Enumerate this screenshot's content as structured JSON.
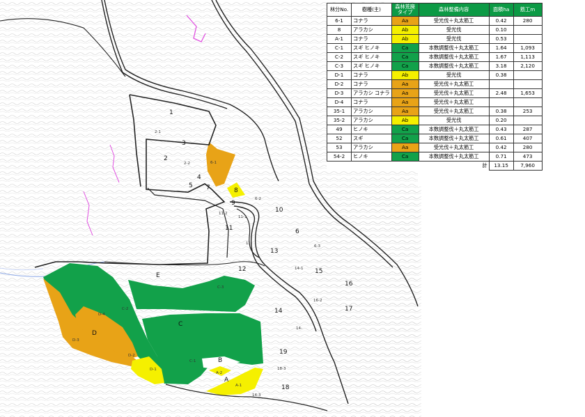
{
  "table": {
    "headers": {
      "no": "林分No.",
      "species": "樹種(主)",
      "type": "森林荒廃タイプ",
      "work": "森林整備内容",
      "area": "面積ha",
      "length": "筋工m"
    },
    "rows": [
      {
        "no": "6-1",
        "species": "コナラ",
        "type": "Aa",
        "work": "受光伐＋丸太筋工",
        "area": "0.42",
        "length": "280"
      },
      {
        "no": "8",
        "species": "アラカシ",
        "type": "Ab",
        "work": "受光伐",
        "area": "0.10",
        "length": ""
      },
      {
        "no": "A-1",
        "species": "コナラ",
        "type": "Ab",
        "work": "受光伐",
        "area": "0.53",
        "length": ""
      },
      {
        "no": "C-1",
        "species": "スギ ヒノキ",
        "type": "Ca",
        "work": "本数調整伐＋丸太筋工",
        "area": "1.64",
        "length": "1,093"
      },
      {
        "no": "C-2",
        "species": "スギ ヒノキ",
        "type": "Ca",
        "work": "本数調整伐＋丸太筋工",
        "area": "1.67",
        "length": "1,113"
      },
      {
        "no": "C-3",
        "species": "スギ ヒノキ",
        "type": "Ca",
        "work": "本数調整伐＋丸太筋工",
        "area": "3.18",
        "length": "2,120"
      },
      {
        "no": "D-1",
        "species": "コナラ",
        "type": "Ab",
        "work": "受光伐",
        "area": "0.38",
        "length": ""
      },
      {
        "no": "D-2",
        "species": "コナラ",
        "type": "Aa",
        "work": "受光伐＋丸太筋工",
        "area": "",
        "length": ""
      },
      {
        "no": "D-3",
        "species": "アラカシ コナラ",
        "type": "Aa",
        "work": "受光伐＋丸太筋工",
        "area": "2.48",
        "length": "1,653"
      },
      {
        "no": "D-4",
        "species": "コナラ",
        "type": "Aa",
        "work": "受光伐＋丸太筋工",
        "area": "",
        "length": ""
      },
      {
        "no": "35-1",
        "species": "アラカシ",
        "type": "Aa",
        "work": "受光伐＋丸太筋工",
        "area": "0.38",
        "length": "253"
      },
      {
        "no": "35-2",
        "species": "アラカシ",
        "type": "Ab",
        "work": "受光伐",
        "area": "0.20",
        "length": ""
      },
      {
        "no": "49",
        "species": "ヒノキ",
        "type": "Ca",
        "work": "本数調整伐＋丸太筋工",
        "area": "0.43",
        "length": "287"
      },
      {
        "no": "52",
        "species": "スギ",
        "type": "Ca",
        "work": "本数調整伐＋丸太筋工",
        "area": "0.61",
        "length": "407"
      },
      {
        "no": "53",
        "species": "アラカシ",
        "type": "Aa",
        "work": "受光伐＋丸太筋工",
        "area": "0.42",
        "length": "280"
      },
      {
        "no": "54-2",
        "species": "ヒノキ",
        "type": "Ca",
        "work": "本数調整伐＋丸太筋工",
        "area": "0.71",
        "length": "473"
      }
    ],
    "total": {
      "label": "計",
      "area": "13.15",
      "length": "7,960"
    }
  },
  "type_colors": {
    "Aa": "#e8a317",
    "Ab": "#f5f000",
    "Ca": "#12a14a"
  },
  "map_labels": {
    "stand_1": "1",
    "stand_2": "2",
    "stand_3": "3",
    "stand_4": "4",
    "stand_5": "5",
    "stand_6": "6",
    "stand_7": "7",
    "stand_8": "8",
    "stand_9": "9",
    "stand_10": "10",
    "stand_11": "11",
    "stand_12": "12",
    "stand_13": "13",
    "stand_14": "14",
    "stand_15": "15",
    "stand_16": "16",
    "stand_17": "17",
    "stand_18": "18",
    "stand_19": "19",
    "stand_A": "A",
    "stand_B": "B",
    "stand_C": "C",
    "stand_D": "D",
    "stand_E": "E",
    "sub_6_1": "6-1",
    "sub_2_1": "2-1",
    "sub_2_2": "2-2",
    "sub_6_2": "6-2",
    "sub_11_2": "11-2",
    "sub_11_1": "11-1",
    "sub_11_3": "11-",
    "sub_6_3": "6-3",
    "sub_14_1": "14-1",
    "sub_16_2": "16-2",
    "sub_14_2": "14-",
    "sub_C_3": "C-3",
    "sub_C_2": "C-2",
    "sub_C_1": "C-1",
    "sub_D_4": "D-4",
    "sub_D_3": "D-3",
    "sub_D_2": "D-2",
    "sub_D_1": "D-1",
    "sub_A_2": "A-2",
    "sub_A_1": "A-1",
    "sub_18_3": "18-3",
    "sub_14_3": "14-3"
  }
}
